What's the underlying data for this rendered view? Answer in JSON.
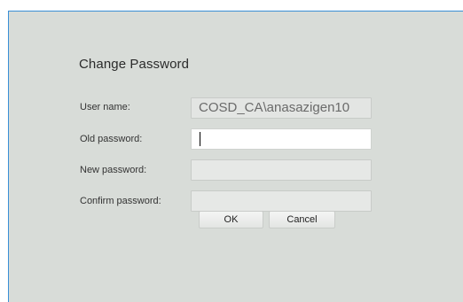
{
  "dialog": {
    "title": "Change Password",
    "username_label": "User name:",
    "username_value": "COSD_CA\\anasazigen10",
    "old_password_label": "Old password:",
    "new_password_label": "New password:",
    "confirm_password_label": "Confirm password:",
    "old_password_value": "",
    "new_password_value": "",
    "confirm_password_value": "",
    "ok_label": "OK",
    "cancel_label": "Cancel"
  },
  "colors": {
    "panel_bg": "#d8dcd8",
    "accent_border": "#3a8fd6"
  }
}
